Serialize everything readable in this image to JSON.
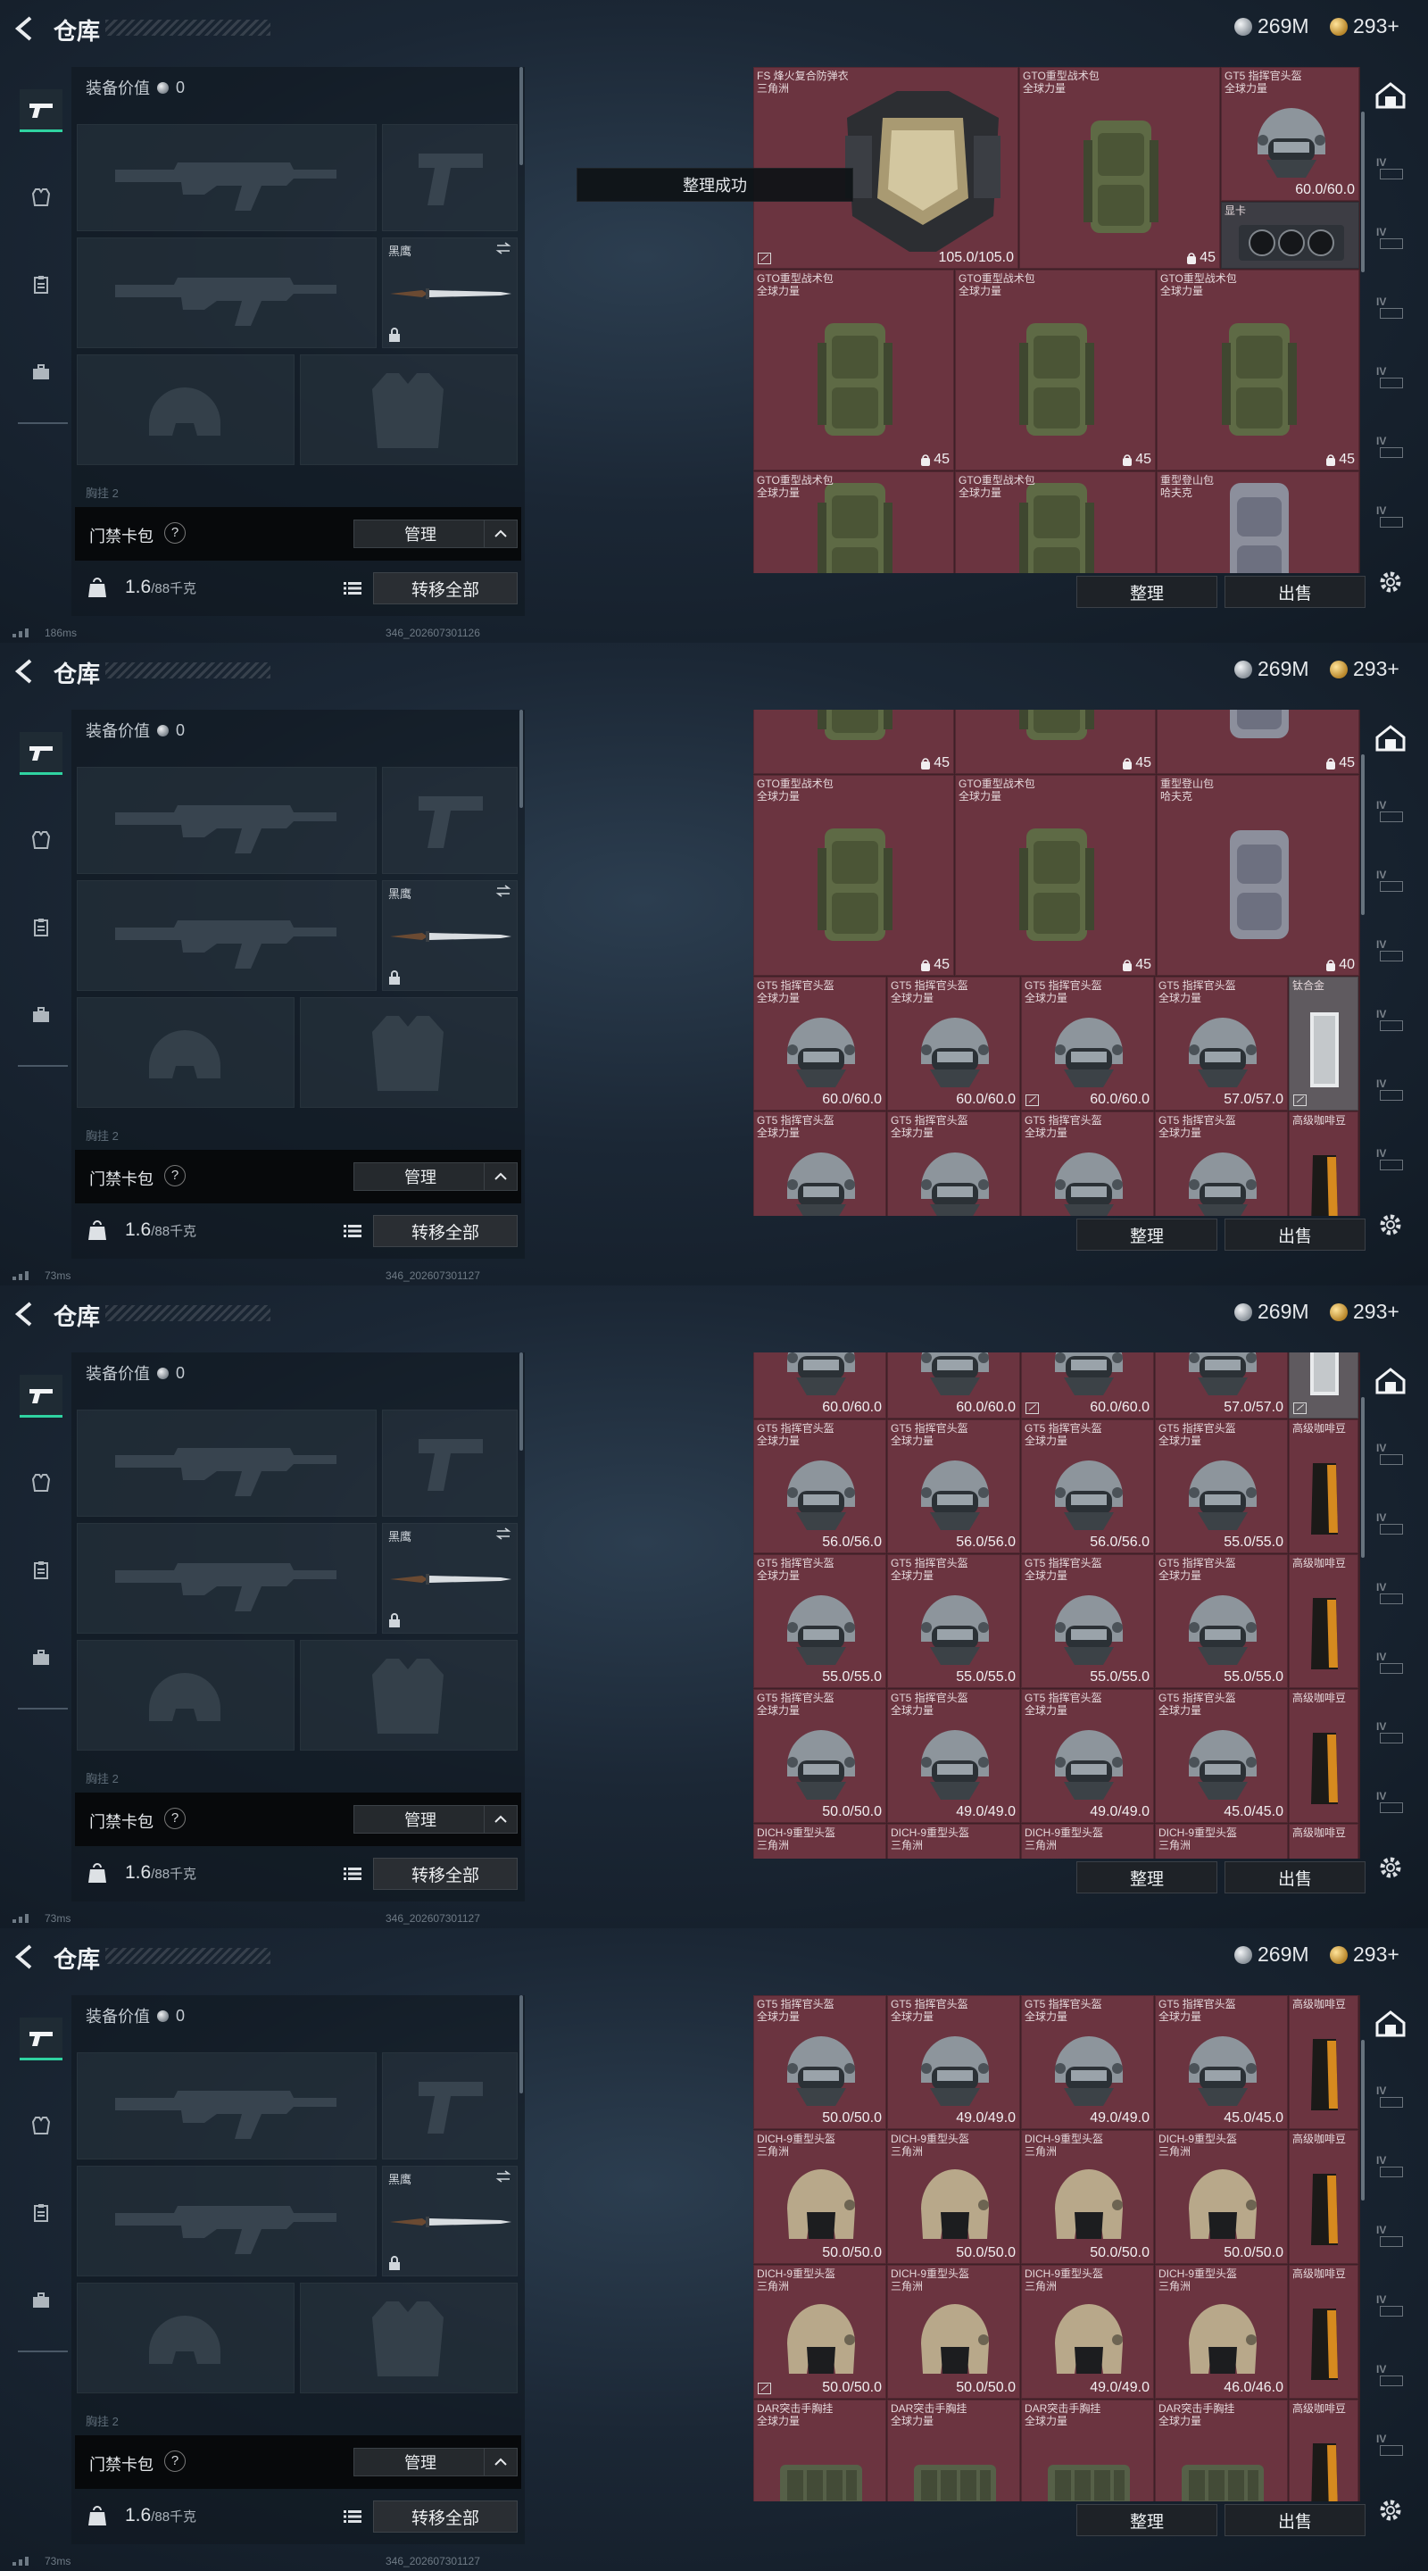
{
  "header": {
    "title": "仓库",
    "silver": "269M",
    "gold": "293+"
  },
  "loadout": {
    "equip_value_label": "装备价值",
    "equip_value": "0",
    "melee_label": "黑鹰",
    "cutoff_label": "胸挂 2"
  },
  "keycard": {
    "label": "门禁卡包",
    "help": "?",
    "manage": "管理"
  },
  "footer": {
    "weight": "1.6",
    "weight_cap": "/88千克",
    "transfer_all": "转移全部"
  },
  "stash_buttons": {
    "sort": "整理",
    "sell": "出售"
  },
  "toast": "整理成功",
  "screens": [
    {
      "ping": "186ms",
      "build": "346_202607301126",
      "items": [
        {
          "type": "armor",
          "name": "FS 烽火复合防弹衣\n三角洲",
          "dur": "105.0/105.0",
          "lock": true,
          "bg": "red"
        },
        {
          "type": "backpack",
          "name": "GTO重型战术包\n全球力量",
          "cap": "45",
          "bg": "red"
        },
        {
          "type": "helmet",
          "name": "GT5 指挥官头盔\n全球力量",
          "dur": "60.0/60.0",
          "bg": "red"
        },
        {
          "type": "gpu",
          "name": "显卡",
          "bg": "dark"
        },
        {
          "type": "backpack",
          "name": "GTO重型战术包\n全球力量",
          "cap": "45",
          "bg": "red"
        },
        {
          "type": "backpack",
          "name": "GTO重型战术包\n全球力量",
          "cap": "45",
          "bg": "red"
        },
        {
          "type": "backpack",
          "name": "GTO重型战术包\n全球力量",
          "cap": "45",
          "bg": "red"
        },
        {
          "type": "backpack",
          "name": "GTO重型战术包\n全球力量",
          "cap": "",
          "bg": "red"
        },
        {
          "type": "backpack",
          "name": "GTO重型战术包\n全球力量",
          "cap": "",
          "bg": "red"
        },
        {
          "type": "backpack-grey",
          "name": "重型登山包\n哈夫克",
          "cap": "",
          "bg": "red"
        }
      ]
    },
    {
      "ping": "73ms",
      "build": "346_202607301127",
      "items": [
        {
          "type": "backpack",
          "name": "",
          "cap": "45",
          "bg": "red"
        },
        {
          "type": "backpack",
          "name": "",
          "cap": "45",
          "bg": "red"
        },
        {
          "type": "backpack-grey",
          "name": "",
          "cap": "45",
          "bg": "red"
        },
        {
          "type": "backpack",
          "name": "GTO重型战术包\n全球力量",
          "cap": "45",
          "bg": "red"
        },
        {
          "type": "backpack",
          "name": "GTO重型战术包\n全球力量",
          "cap": "45",
          "bg": "red"
        },
        {
          "type": "backpack-grey",
          "name": "重型登山包\n哈夫克",
          "cap": "40",
          "bg": "red"
        },
        {
          "type": "helmet",
          "name": "GT5 指挥官头盔\n全球力量",
          "dur": "60.0/60.0",
          "bg": "red"
        },
        {
          "type": "helmet",
          "name": "GT5 指挥官头盔\n全球力量",
          "dur": "60.0/60.0",
          "bg": "red"
        },
        {
          "type": "helmet",
          "name": "GT5 指挥官头盔\n全球力量",
          "dur": "60.0/60.0",
          "lock": true,
          "bg": "red"
        },
        {
          "type": "helmet",
          "name": "GT5 指挥官头盔\n全球力量",
          "dur": "57.0/57.0",
          "bg": "red"
        },
        {
          "type": "metal",
          "name": "钛合金",
          "lock": true,
          "bg": "grey"
        },
        {
          "type": "helmet",
          "name": "GT5 指挥官头盔\n全球力量",
          "dur": "",
          "bg": "red"
        },
        {
          "type": "helmet",
          "name": "GT5 指挥官头盔\n全球力量",
          "dur": "",
          "bg": "red"
        },
        {
          "type": "helmet",
          "name": "GT5 指挥官头盔\n全球力量",
          "dur": "",
          "bg": "red"
        },
        {
          "type": "helmet",
          "name": "GT5 指挥官头盔\n全球力量",
          "dur": "",
          "bg": "red"
        },
        {
          "type": "coffee",
          "name": "高级咖啡豆",
          "bg": "red"
        }
      ]
    },
    {
      "ping": "73ms",
      "build": "346_202607301127",
      "items": [
        {
          "type": "helmet",
          "name": "",
          "dur": "60.0/60.0",
          "bg": "red"
        },
        {
          "type": "helmet",
          "name": "",
          "dur": "60.0/60.0",
          "bg": "red"
        },
        {
          "type": "helmet",
          "name": "",
          "dur": "60.0/60.0",
          "lock": true,
          "bg": "red"
        },
        {
          "type": "helmet",
          "name": "",
          "dur": "57.0/57.0",
          "bg": "red"
        },
        {
          "type": "metal",
          "name": "",
          "lock": true,
          "bg": "grey"
        },
        {
          "type": "helmet",
          "name": "GT5 指挥官头盔\n全球力量",
          "dur": "56.0/56.0",
          "bg": "red"
        },
        {
          "type": "helmet",
          "name": "GT5 指挥官头盔\n全球力量",
          "dur": "56.0/56.0",
          "bg": "red"
        },
        {
          "type": "helmet",
          "name": "GT5 指挥官头盔\n全球力量",
          "dur": "56.0/56.0",
          "bg": "red"
        },
        {
          "type": "helmet",
          "name": "GT5 指挥官头盔\n全球力量",
          "dur": "55.0/55.0",
          "bg": "red"
        },
        {
          "type": "coffee",
          "name": "高级咖啡豆",
          "bg": "red"
        },
        {
          "type": "helmet",
          "name": "GT5 指挥官头盔\n全球力量",
          "dur": "55.0/55.0",
          "bg": "red"
        },
        {
          "type": "helmet",
          "name": "GT5 指挥官头盔\n全球力量",
          "dur": "55.0/55.0",
          "bg": "red"
        },
        {
          "type": "helmet",
          "name": "GT5 指挥官头盔\n全球力量",
          "dur": "55.0/55.0",
          "bg": "red"
        },
        {
          "type": "helmet",
          "name": "GT5 指挥官头盔\n全球力量",
          "dur": "55.0/55.0",
          "bg": "red"
        },
        {
          "type": "coffee",
          "name": "高级咖啡豆",
          "bg": "red"
        },
        {
          "type": "helmet",
          "name": "GT5 指挥官头盔\n全球力量",
          "dur": "50.0/50.0",
          "bg": "red"
        },
        {
          "type": "helmet",
          "name": "GT5 指挥官头盔\n全球力量",
          "dur": "49.0/49.0",
          "bg": "red"
        },
        {
          "type": "helmet",
          "name": "GT5 指挥官头盔\n全球力量",
          "dur": "49.0/49.0",
          "bg": "red"
        },
        {
          "type": "helmet",
          "name": "GT5 指挥官头盔\n全球力量",
          "dur": "45.0/45.0",
          "bg": "red"
        },
        {
          "type": "coffee",
          "name": "高级咖啡豆",
          "bg": "red"
        },
        {
          "type": "dich",
          "name": "DICH-9重型头盔\n三角洲",
          "dur": "",
          "bg": "red"
        },
        {
          "type": "dich",
          "name": "DICH-9重型头盔\n三角洲",
          "dur": "",
          "bg": "red"
        },
        {
          "type": "dich",
          "name": "DICH-9重型头盔\n三角洲",
          "dur": "",
          "bg": "red"
        },
        {
          "type": "dich",
          "name": "DICH-9重型头盔\n三角洲",
          "dur": "",
          "bg": "red"
        },
        {
          "type": "coffee",
          "name": "高级咖啡豆",
          "bg": "red"
        }
      ]
    },
    {
      "ping": "73ms",
      "build": "346_202607301127",
      "items": [
        {
          "type": "helmet",
          "name": "GT5 指挥官头盔\n全球力量",
          "dur": "50.0/50.0",
          "bg": "red"
        },
        {
          "type": "helmet",
          "name": "GT5 指挥官头盔\n全球力量",
          "dur": "49.0/49.0",
          "bg": "red"
        },
        {
          "type": "helmet",
          "name": "GT5 指挥官头盔\n全球力量",
          "dur": "49.0/49.0",
          "bg": "red"
        },
        {
          "type": "helmet",
          "name": "GT5 指挥官头盔\n全球力量",
          "dur": "45.0/45.0",
          "bg": "red"
        },
        {
          "type": "coffee",
          "name": "高级咖啡豆",
          "bg": "red"
        },
        {
          "type": "dich",
          "name": "DICH-9重型头盔\n三角洲",
          "dur": "50.0/50.0",
          "bg": "red"
        },
        {
          "type": "dich",
          "name": "DICH-9重型头盔\n三角洲",
          "dur": "50.0/50.0",
          "bg": "red"
        },
        {
          "type": "dich",
          "name": "DICH-9重型头盔\n三角洲",
          "dur": "50.0/50.0",
          "bg": "red"
        },
        {
          "type": "dich",
          "name": "DICH-9重型头盔\n三角洲",
          "dur": "50.0/50.0",
          "bg": "red"
        },
        {
          "type": "coffee",
          "name": "高级咖啡豆",
          "bg": "red"
        },
        {
          "type": "dich",
          "name": "DICH-9重型头盔\n三角洲",
          "dur": "50.0/50.0",
          "lock": true,
          "bg": "red"
        },
        {
          "type": "dich",
          "name": "DICH-9重型头盔\n三角洲",
          "dur": "50.0/50.0",
          "bg": "red"
        },
        {
          "type": "dich",
          "name": "DICH-9重型头盔\n三角洲",
          "dur": "49.0/49.0",
          "bg": "red"
        },
        {
          "type": "dich",
          "name": "DICH-9重型头盔\n三角洲",
          "dur": "46.0/46.0",
          "bg": "red"
        },
        {
          "type": "coffee",
          "name": "高级咖啡豆",
          "bg": "red"
        },
        {
          "type": "rig",
          "name": "DAR突击手胸挂\n全球力量",
          "dur": "",
          "bg": "red"
        },
        {
          "type": "rig",
          "name": "DAR突击手胸挂\n全球力量",
          "dur": "",
          "bg": "red"
        },
        {
          "type": "rig",
          "name": "DAR突击手胸挂\n全球力量",
          "dur": "",
          "bg": "red"
        },
        {
          "type": "rig",
          "name": "DAR突击手胸挂\n全球力量",
          "dur": "",
          "bg": "red"
        },
        {
          "type": "coffee",
          "name": "高级咖啡豆",
          "bg": "red"
        }
      ]
    }
  ]
}
